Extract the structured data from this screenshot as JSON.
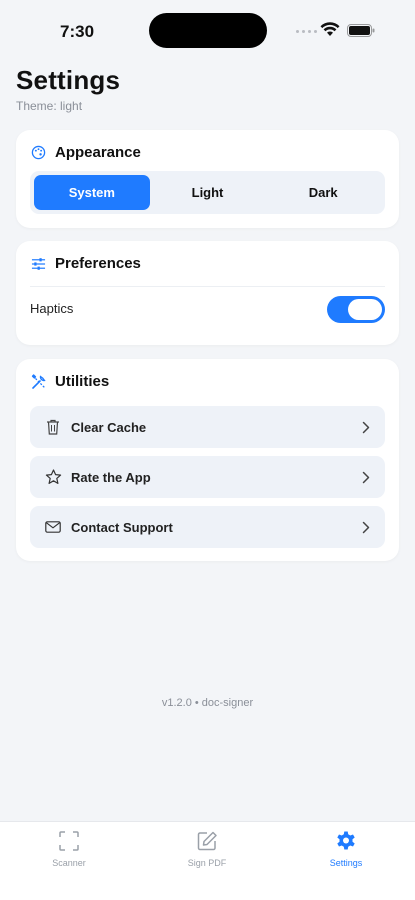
{
  "status_bar": {
    "time": "7:30"
  },
  "header": {
    "title": "Settings",
    "subtitle": "Theme: light"
  },
  "appearance": {
    "title": "Appearance",
    "icon": "palette-icon",
    "options": [
      "System",
      "Light",
      "Dark"
    ],
    "selected": "System"
  },
  "preferences": {
    "title": "Preferences",
    "icon": "sliders-icon",
    "haptics_label": "Haptics",
    "haptics_on": true
  },
  "utilities": {
    "title": "Utilities",
    "icon": "tools-icon",
    "items": [
      {
        "label": "Clear Cache",
        "icon": "trash-icon"
      },
      {
        "label": "Rate the App",
        "icon": "star-icon"
      },
      {
        "label": "Contact Support",
        "icon": "mail-icon"
      }
    ]
  },
  "footer": {
    "version": "v1.2.0 • doc-signer"
  },
  "tabs": [
    {
      "label": "Scanner",
      "icon": "scan-icon",
      "active": false
    },
    {
      "label": "Sign PDF",
      "icon": "edit-icon",
      "active": false
    },
    {
      "label": "Settings",
      "icon": "gear-icon",
      "active": true
    }
  ],
  "colors": {
    "accent": "#1f7bff",
    "background": "#f3f5f8",
    "row_bg": "#eef2f8"
  }
}
